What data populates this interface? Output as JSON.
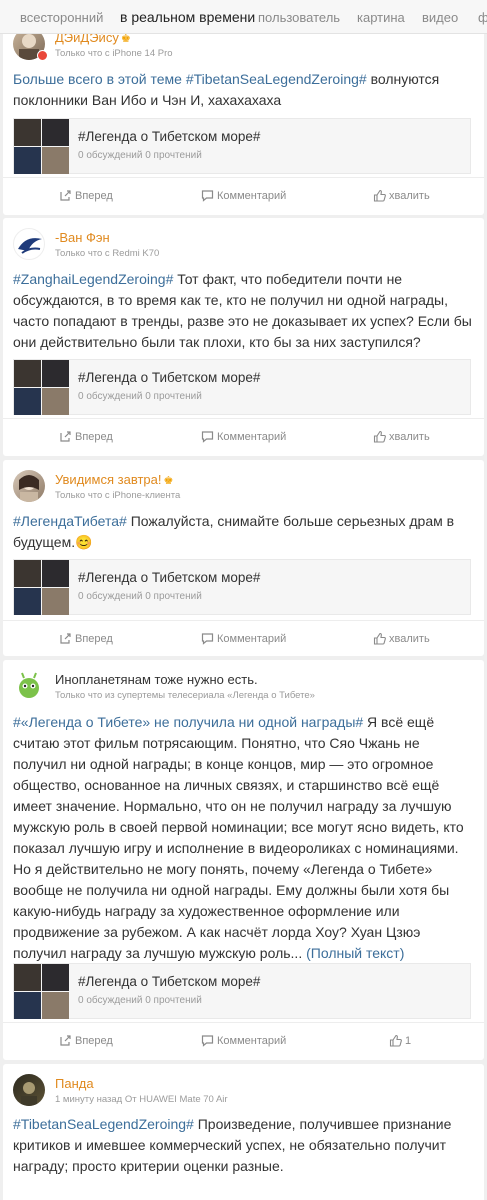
{
  "tabs": [
    "всесторонний",
    "в реальном времени",
    "пользователь",
    "картина",
    "видео",
    "ф"
  ],
  "posts": [
    {
      "name": "ДЭйДЭйсу",
      "meta": "Только что с iPhone 14 Pro",
      "tag": "Больше всего в этой теме #TibetanSeaLegendZeroing#",
      "text": " волнуются поклонники Ван Ибо и Чэн И, хахахахаха",
      "topic_title": "#Легенда о Тибетском море#",
      "topic_stats": "0 обсуждений 0 прочтений",
      "forward": "Вперед",
      "comment": "Комментарий",
      "like": "хвалить"
    },
    {
      "name": "-Ван Фэн",
      "meta": "Только что с Redmi K70",
      "tag": "#ZanghaiLegendZeroing#",
      "text": " Тот факт, что победители почти не обсуждаются, в то время как те, кто не получил ни одной награды, часто попадают в тренды, разве это не доказывает их успех? Если бы они действительно были так плохи, кто бы за них заступился?",
      "topic_title": "#Легенда о Тибетском море#",
      "topic_stats": "0 обсуждений 0 прочтений",
      "forward": "Вперед",
      "comment": "Комментарий",
      "like": "хвалить"
    },
    {
      "name": "Увидимся завтра!",
      "meta": "Только что с iPhone-клиента",
      "tag": "#ЛегендаТибета#",
      "text": " Пожалуйста, снимайте больше серьезных драм в будущем.😊",
      "topic_title": "#Легенда о Тибетском море#",
      "topic_stats": "0 обсуждений 0 прочтений",
      "forward": "Вперед",
      "comment": "Комментарий",
      "like": "хвалить"
    },
    {
      "name": "Инопланетянам тоже нужно есть.",
      "meta": "Только что из супертемы телесериала «Легенда о Тибете»",
      "tag": "#«Легенда о Тибете» не получила ни одной награды#",
      "text": " Я всё ещё считаю этот фильм потрясающим. Понятно, что Сяо Чжань не получил ни одной награды; в конце концов, мир — это огромное общество, основанное на личных связях, и старшинство всё ещё имеет значение. Нормально, что он не получил награду за лучшую мужскую роль в своей первой номинации; все могут ясно видеть, кто показал лучшую игру и исполнение в видеороликах с номинациями. Но я действительно не могу понять, почему «Легенда о Тибете» вообще не получила ни одной награды. Ему должны были хотя бы какую-нибудь награду за художественное оформление или продвижение за рубежом. А как насчёт лорда Хоу? Хуан Цзюэ получил награду за лучшую мужскую роль...",
      "more": "(Полный текст)",
      "topic_title": "#Легенда о Тибетском море#",
      "topic_stats": "0 обсуждений 0 прочтений",
      "forward": "Вперед",
      "comment": "Комментарий",
      "like": "1"
    },
    {
      "name": "Панда",
      "meta": "1 минуту назад От HUAWEI Mate 70 Air",
      "tag": "#TibetanSeaLegendZeroing#",
      "text": " Произведение, получившее признание критиков и имевшее коммерческий успех, не обязательно получит награду; просто критерии оценки разные."
    }
  ],
  "icons": {
    "forward": "share-icon",
    "comment": "comment-icon",
    "like": "thumbs-up-icon",
    "crown": "crown-icon"
  },
  "colors": {
    "link": "#3c6e9a",
    "username": "#e08a1f",
    "meta": "#9b9b9b",
    "background": "#efefef"
  }
}
